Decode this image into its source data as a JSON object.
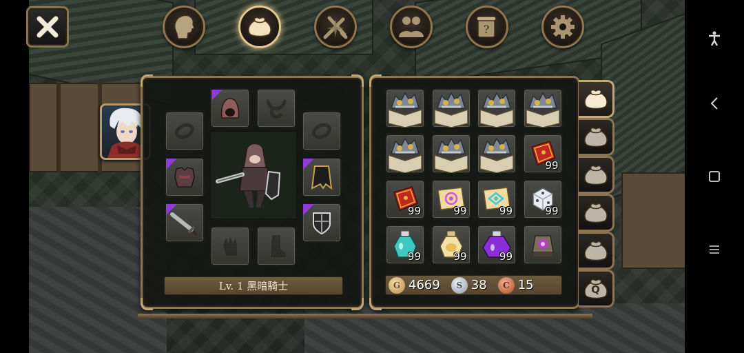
{
  "toolbar": {
    "close_icon": "close-x-icon",
    "tabs": [
      {
        "id": "character",
        "icon": "head-silhouette-icon",
        "active": false
      },
      {
        "id": "inventory",
        "icon": "bag-icon",
        "active": true
      },
      {
        "id": "skills",
        "icon": "crossed-swords-icon",
        "active": false
      },
      {
        "id": "party",
        "icon": "people-icon",
        "active": false
      },
      {
        "id": "quests",
        "icon": "scroll-icon",
        "active": false
      },
      {
        "id": "settings",
        "icon": "gear-icon",
        "active": false
      }
    ]
  },
  "character": {
    "portrait": "white-haired-knight-portrait",
    "level_text": "Lv. 1 黑暗騎士",
    "equipment": [
      {
        "slot": "helmet",
        "item": "hood-helmet",
        "equipped": true,
        "rarity": "epic"
      },
      {
        "slot": "necklace",
        "item": "necklace-outline",
        "equipped": false
      },
      {
        "slot": "ring-left",
        "item": "ring-outline",
        "equipped": false
      },
      {
        "slot": "ring-right",
        "item": "ring-outline",
        "equipped": false
      },
      {
        "slot": "armor",
        "item": "dark-armor",
        "equipped": true,
        "rarity": "epic"
      },
      {
        "slot": "cloak",
        "item": "black-cloak",
        "equipped": true,
        "rarity": "epic"
      },
      {
        "slot": "weapon",
        "item": "greatsword",
        "equipped": true,
        "rarity": "epic"
      },
      {
        "slot": "shield",
        "item": "knight-shield",
        "equipped": true,
        "rarity": "epic"
      },
      {
        "slot": "gloves",
        "item": "glove-outline",
        "equipped": false
      },
      {
        "slot": "boots",
        "item": "boot-outline",
        "equipped": false
      }
    ]
  },
  "inventory": {
    "items": [
      {
        "name": "gear-crate",
        "qty": ""
      },
      {
        "name": "gear-crate",
        "qty": ""
      },
      {
        "name": "gear-crate",
        "qty": ""
      },
      {
        "name": "gear-crate",
        "qty": ""
      },
      {
        "name": "gear-crate",
        "qty": ""
      },
      {
        "name": "gear-crate",
        "qty": ""
      },
      {
        "name": "gear-crate",
        "qty": ""
      },
      {
        "name": "red-book",
        "qty": "99"
      },
      {
        "name": "red-book",
        "qty": "99"
      },
      {
        "name": "magenta-scroll",
        "qty": "99"
      },
      {
        "name": "cyan-scroll",
        "qty": "99"
      },
      {
        "name": "white-dice",
        "qty": "99"
      },
      {
        "name": "cyan-potion",
        "qty": "99"
      },
      {
        "name": "gold-potion",
        "qty": "99"
      },
      {
        "name": "purple-potion",
        "qty": "99"
      },
      {
        "name": "purple-orb-lantern",
        "qty": ""
      }
    ],
    "currency": {
      "gold": {
        "symbol": "G",
        "value": "4669",
        "color": "#d8b27a"
      },
      "silver": {
        "symbol": "S",
        "value": "38",
        "color": "#b9c0c8"
      },
      "copper": {
        "symbol": "C",
        "value": "15",
        "color": "#d07a4e"
      }
    },
    "bag_tabs": [
      {
        "label": "",
        "icon": "bag-icon",
        "active": true
      },
      {
        "label": "",
        "icon": "bag-icon",
        "active": false
      },
      {
        "label": "",
        "icon": "bag-icon",
        "active": false
      },
      {
        "label": "",
        "icon": "bag-icon",
        "active": false
      },
      {
        "label": "",
        "icon": "bag-icon",
        "active": false
      },
      {
        "label": "Q",
        "icon": "quest-bag-icon",
        "active": false
      }
    ]
  },
  "colors": {
    "frame": "#8b7552",
    "frame_highlight": "#c3a877",
    "epic": "#8f3bd6"
  }
}
